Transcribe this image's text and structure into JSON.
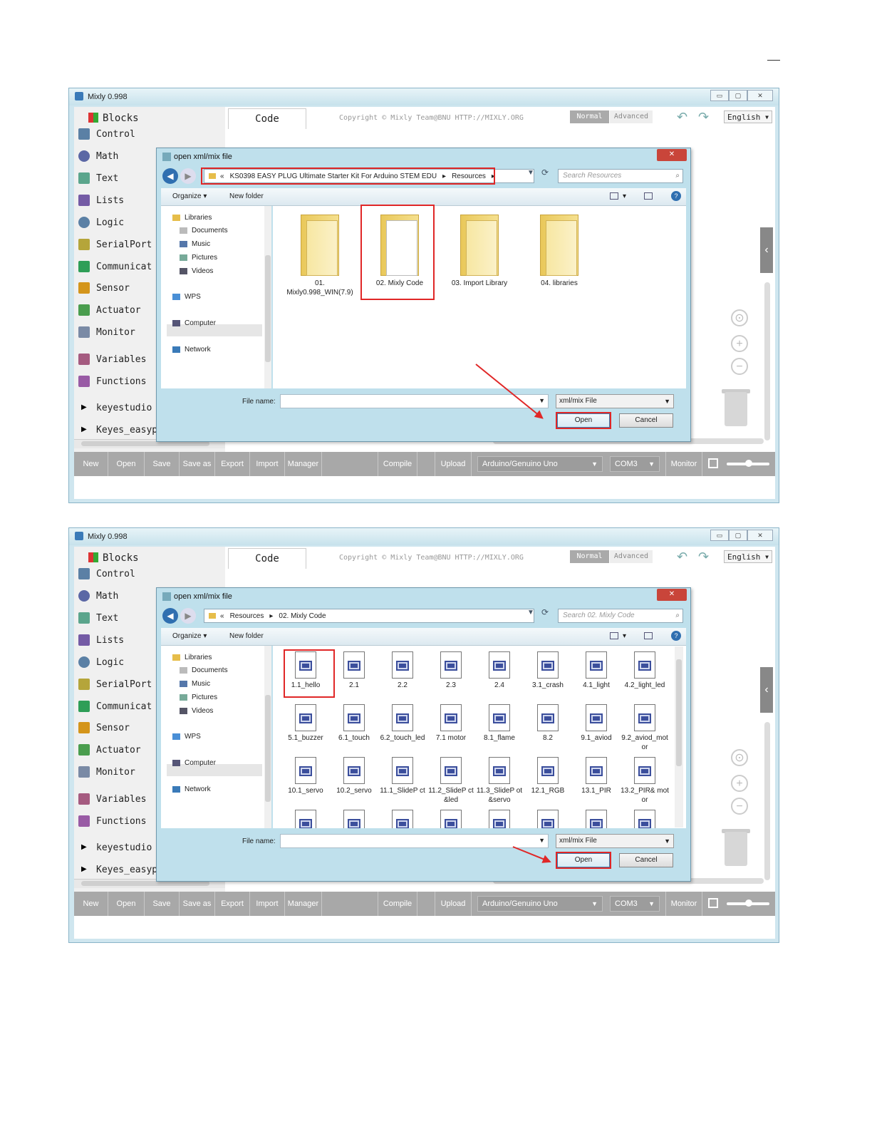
{
  "app": {
    "title": "Mixly 0.998",
    "blocks_label": "Blocks",
    "code_tab": "Code",
    "copyright": "Copyright © Mixly Team@BNU HTTP://MIXLY.ORG",
    "mode_normal": "Normal",
    "mode_advanced": "Advanced",
    "language": "English",
    "categories": [
      "Control",
      "Math",
      "Text",
      "Lists",
      "Logic",
      "SerialPort",
      "Communicat",
      "Sensor",
      "Actuator",
      "Monitor",
      "Variables",
      "Functions"
    ],
    "category_colors": [
      "#5b80a5",
      "#5b67a5",
      "#5ba58c",
      "#745ba5",
      "#5b80a5",
      "#b5a53a",
      "#2e9e57",
      "#d4951b",
      "#4a9d4e",
      "#7a8aa5",
      "#a55b80",
      "#995ba5"
    ],
    "extensions": [
      "keyestudio",
      "Keyes_easypulg"
    ],
    "toolbar": {
      "new": "New",
      "open": "Open",
      "save": "Save",
      "save_as": "Save as",
      "export": "Export",
      "import": "Import",
      "manager": "Manager",
      "compile": "Compile",
      "upload": "Upload",
      "board": "Arduino/Genuino Uno",
      "port": "COM3",
      "monitor": "Monitor"
    },
    "window_buttons": {
      "minimize": "▭",
      "maximize": "▢",
      "close": "✕"
    }
  },
  "dialog": {
    "title": "open xml/mix file",
    "organize": "Organize",
    "new_folder": "New folder",
    "nav_items": [
      "Libraries",
      "Documents",
      "Music",
      "Pictures",
      "Videos",
      "WPS",
      "Computer",
      "Network"
    ],
    "file_name_label": "File name:",
    "file_type": "xml/mix File",
    "open": "Open",
    "cancel": "Cancel"
  },
  "screens": [
    {
      "address": [
        "«",
        "KS0398 EASY PLUG Ultimate Starter Kit For Arduino STEM EDU",
        "▸",
        "Resources",
        "▸"
      ],
      "search": "Search Resources",
      "folders": [
        "01.\nMixly0.998_WIN(7.9)",
        "02. Mixly Code",
        "03. Import Library",
        "04. libraries"
      ]
    },
    {
      "address": [
        "«",
        "Resources",
        "▸",
        "02. Mixly Code"
      ],
      "search": "Search 02. Mixly Code",
      "files": [
        "1.1_hello",
        "2.1",
        "2.2",
        "2.3",
        "2.4",
        "3.1_crash",
        "4.1_light",
        "4.2_light_led",
        "5.1_buzzer",
        "6.1_touch",
        "6.2_touch_led",
        "7.1 motor",
        "8.1_flame",
        "8.2",
        "9.1_aviod",
        "9.2_aviod_motor",
        "10.1_servo",
        "10.2_servo",
        "11.1_SlideP ct",
        "11.2_SlideP ct&led",
        "11.3_SlideP ot&servo",
        "12.1_RGB",
        "13.1_PIR",
        "13.2_PIR& motor",
        "",
        "",
        "",
        "",
        "",
        "",
        "",
        ""
      ]
    }
  ]
}
